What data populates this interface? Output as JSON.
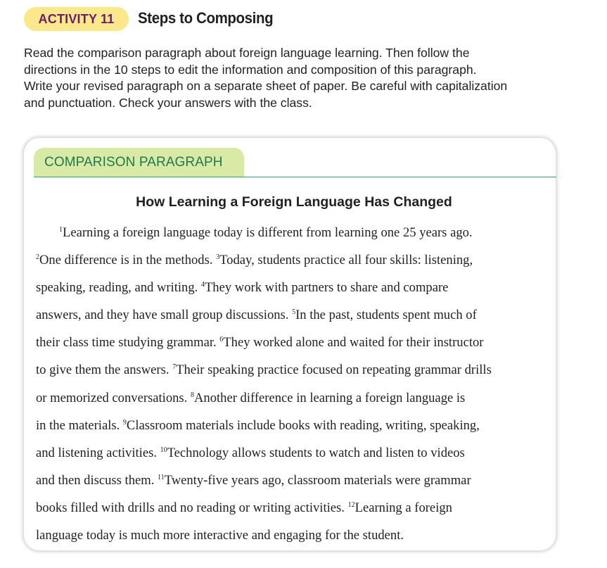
{
  "activity": {
    "label": "ACTIVITY 11",
    "title": "Steps to Composing"
  },
  "instructions": [
    "Read the comparison paragraph about foreign language learning. Then follow the",
    "directions in the 10 steps to edit the information and composition of this paragraph.",
    "Write your revised paragraph on a separate sheet of paper. Be careful with capitalization",
    "and punctuation. Check your answers with the class."
  ],
  "card": {
    "tab_label": "COMPARISON PARAGRAPH",
    "title": "How Learning a Foreign Language Has Changed",
    "lines": [
      [
        {
          "sup": "1"
        },
        {
          "text": "Learning a foreign language today is different from learning one 25 years ago."
        }
      ],
      [
        {
          "sup": "2"
        },
        {
          "text": "One difference is in the methods. "
        },
        {
          "sup": "3"
        },
        {
          "text": "Today, students practice all four skills: listening,"
        }
      ],
      [
        {
          "text": "speaking, reading, and writing. "
        },
        {
          "sup": "4"
        },
        {
          "text": "They work with partners to share and compare"
        }
      ],
      [
        {
          "text": "answers, and they have small group discussions. "
        },
        {
          "sup": "5"
        },
        {
          "text": "In the past, students spent much of"
        }
      ],
      [
        {
          "text": "their class time studying grammar. "
        },
        {
          "sup": "6"
        },
        {
          "text": "They worked alone and waited for their instructor"
        }
      ],
      [
        {
          "text": "to give them the answers. "
        },
        {
          "sup": "7"
        },
        {
          "text": "Their speaking practice focused on repeating grammar drills"
        }
      ],
      [
        {
          "text": "or memorized conversations. "
        },
        {
          "sup": "8"
        },
        {
          "text": "Another difference in learning a foreign language is"
        }
      ],
      [
        {
          "text": "in the materials. "
        },
        {
          "sup": "9"
        },
        {
          "text": "Classroom materials include books with reading, writing, speaking,"
        }
      ],
      [
        {
          "text": "and listening activities. "
        },
        {
          "sup": "10"
        },
        {
          "text": "Technology allows students to watch and listen to videos"
        }
      ],
      [
        {
          "text": "and then discuss them. "
        },
        {
          "sup": "11"
        },
        {
          "text": "Twenty-five years ago, classroom materials were grammar"
        }
      ],
      [
        {
          "text": "books filled with drills and no reading or writing activities. "
        },
        {
          "sup": "12"
        },
        {
          "text": "Learning a foreign"
        }
      ],
      [
        {
          "text": "language today is much more interactive and engaging for the student."
        }
      ]
    ]
  },
  "colors": {
    "pill_bg": "#fbe88a",
    "pill_text": "#6b1e6e",
    "tab_bg": "#d9eaa6",
    "tab_text": "#1e7a4c",
    "rule": "#3a9a6c"
  }
}
